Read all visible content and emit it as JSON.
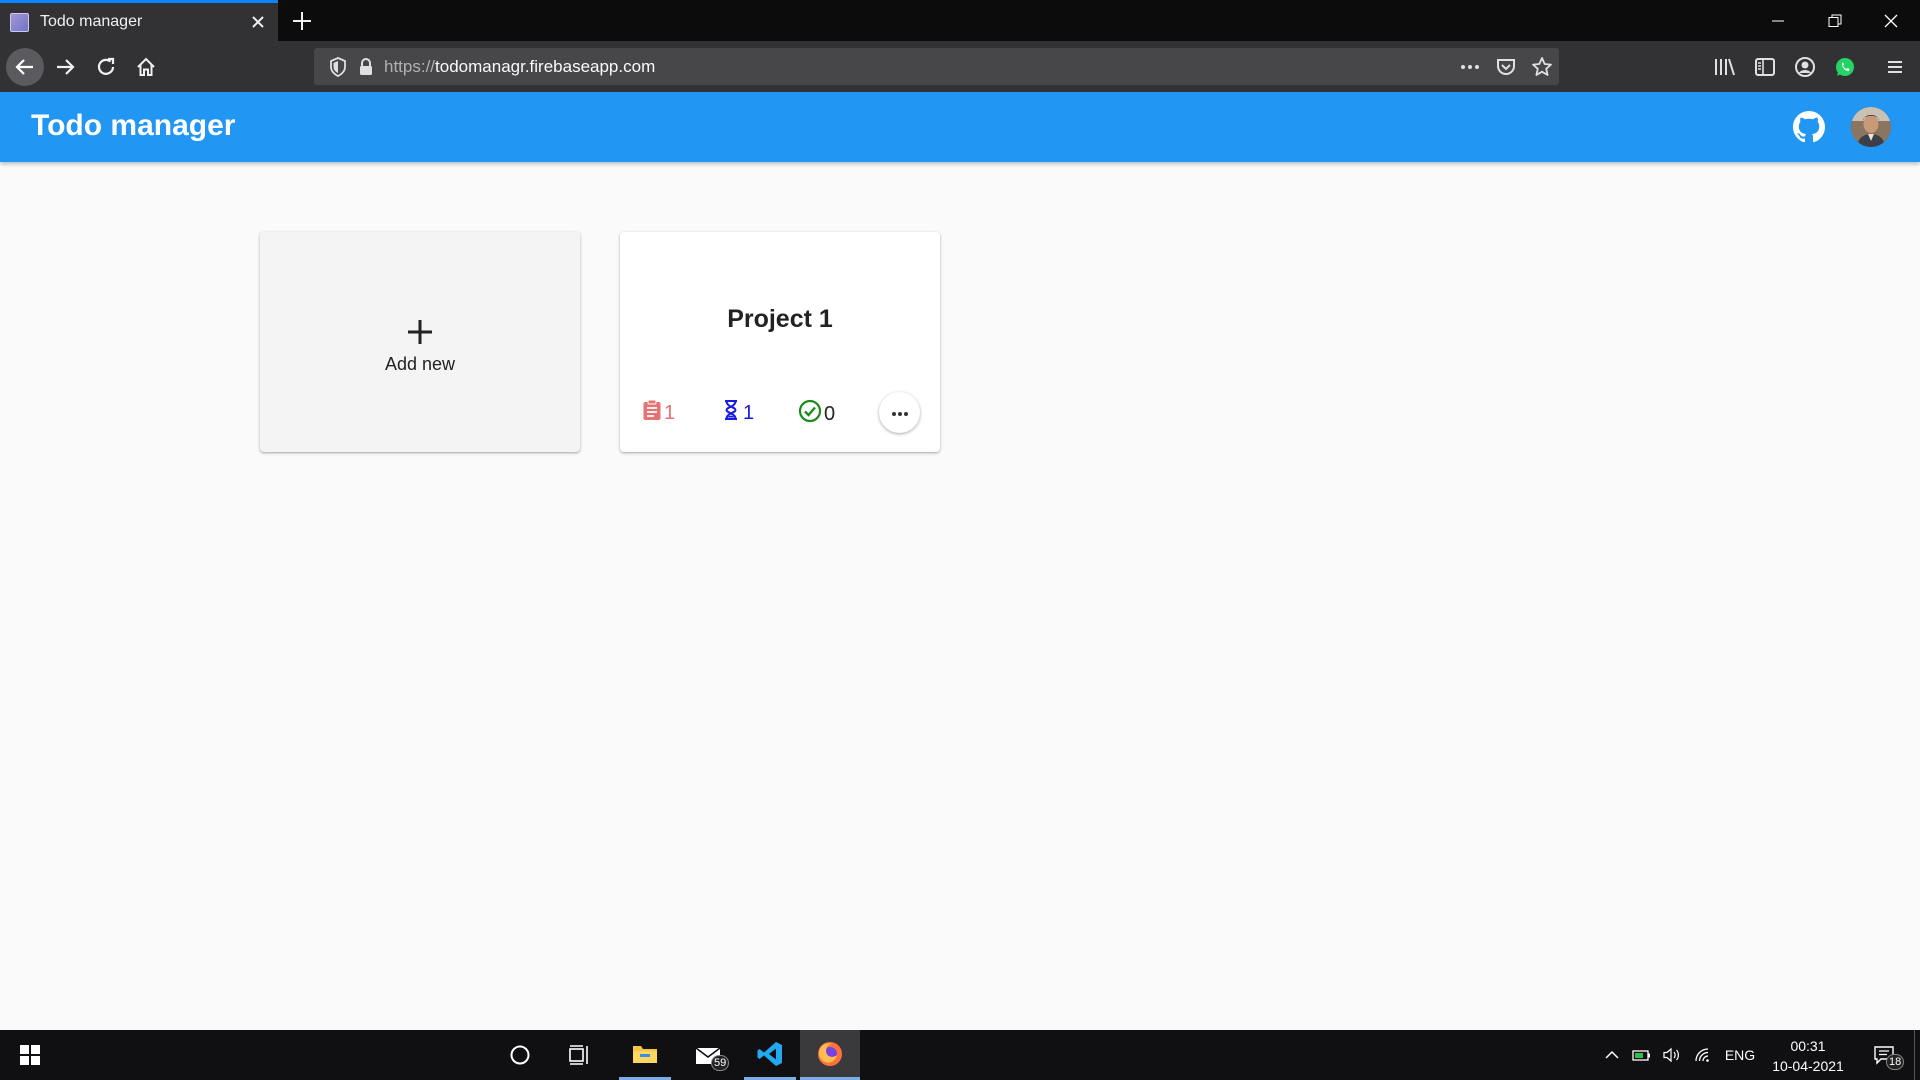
{
  "browser": {
    "tab_title": "Todo manager",
    "url_scheme": "https://",
    "url_host": "todomanagr.firebaseapp.com"
  },
  "app": {
    "title": "Todo manager"
  },
  "cards": {
    "add_new_label": "Add new",
    "project": {
      "title": "Project 1",
      "todo_count": "1",
      "in_progress_count": "1",
      "done_count": "0"
    }
  },
  "colors": {
    "header": "#2196f3",
    "todo": "#e57373",
    "in_progress": "#1a1ae6",
    "done": "#1b8a1b"
  },
  "taskbar": {
    "mail_badge": "59",
    "language": "ENG",
    "time": "00:31",
    "date": "10-04-2021",
    "notification_count": "18"
  }
}
